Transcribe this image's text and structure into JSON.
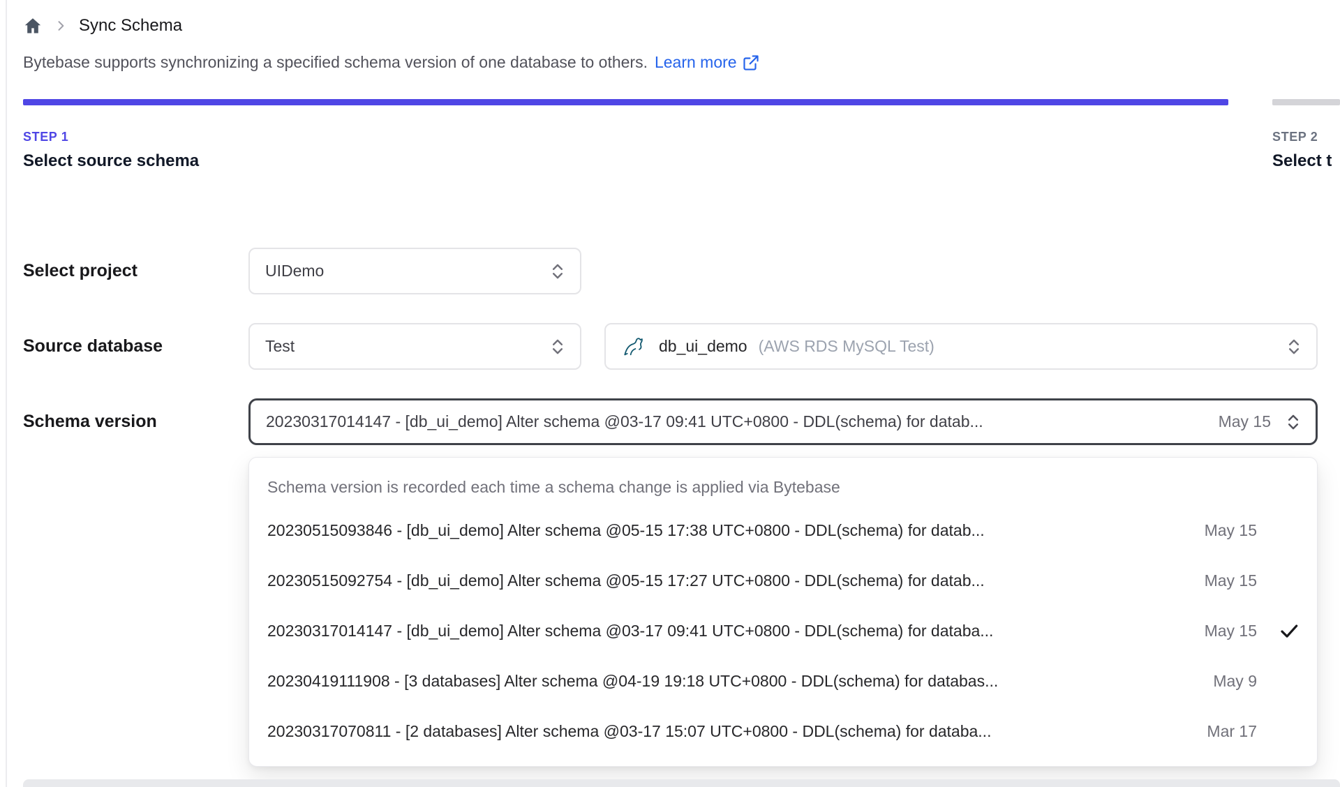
{
  "breadcrumb": {
    "title": "Sync Schema"
  },
  "intro": {
    "text": "Bytebase supports synchronizing a specified schema version of one database to others.",
    "link_label": "Learn more"
  },
  "steps": [
    {
      "label": "STEP 1",
      "title": "Select source schema",
      "state": "active"
    },
    {
      "label": "STEP 2",
      "title": "Select t",
      "state": "upcoming"
    }
  ],
  "form": {
    "project": {
      "label": "Select project",
      "value": "UIDemo"
    },
    "source_database": {
      "label": "Source database",
      "environment_value": "Test",
      "database_value": "db_ui_demo",
      "database_detail": "(AWS RDS MySQL Test)"
    },
    "schema_version": {
      "label": "Schema version",
      "value": "20230317014147 - [db_ui_demo] Alter schema @03-17 09:41 UTC+0800 - DDL(schema) for datab...",
      "value_date": "May 15"
    }
  },
  "dropdown": {
    "hint": "Schema version is recorded each time a schema change is applied via Bytebase",
    "options": [
      {
        "text": "20230515093846 - [db_ui_demo] Alter schema @05-15 17:38 UTC+0800 - DDL(schema) for datab...",
        "date": "May 15",
        "selected": false
      },
      {
        "text": "20230515092754 - [db_ui_demo] Alter schema @05-15 17:27 UTC+0800 - DDL(schema) for datab...",
        "date": "May 15",
        "selected": false
      },
      {
        "text": "20230317014147 - [db_ui_demo] Alter schema @03-17 09:41 UTC+0800 - DDL(schema) for databa...",
        "date": "May 15",
        "selected": true
      },
      {
        "text": "20230419111908 - [3 databases] Alter schema @04-19 19:18 UTC+0800 - DDL(schema) for databas...",
        "date": "May 9",
        "selected": false
      },
      {
        "text": "20230317070811 - [2 databases] Alter schema @03-17 15:07 UTC+0800 - DDL(schema) for databa...",
        "date": "Mar 17",
        "selected": false
      }
    ]
  },
  "icons": {
    "home": "home-icon",
    "chevron_right": "breadcrumb-chevron",
    "external_link": "external-link-icon",
    "select_chevron": "chevron-up-down-icon",
    "mysql": "mysql-dolphin-icon",
    "check": "check-icon"
  },
  "colors": {
    "accent": "#4f46e5",
    "link": "#2563eb",
    "inactive_bar": "#d4d4d8",
    "focus_border": "#3f4249",
    "mysql_icon": "#11586f"
  }
}
